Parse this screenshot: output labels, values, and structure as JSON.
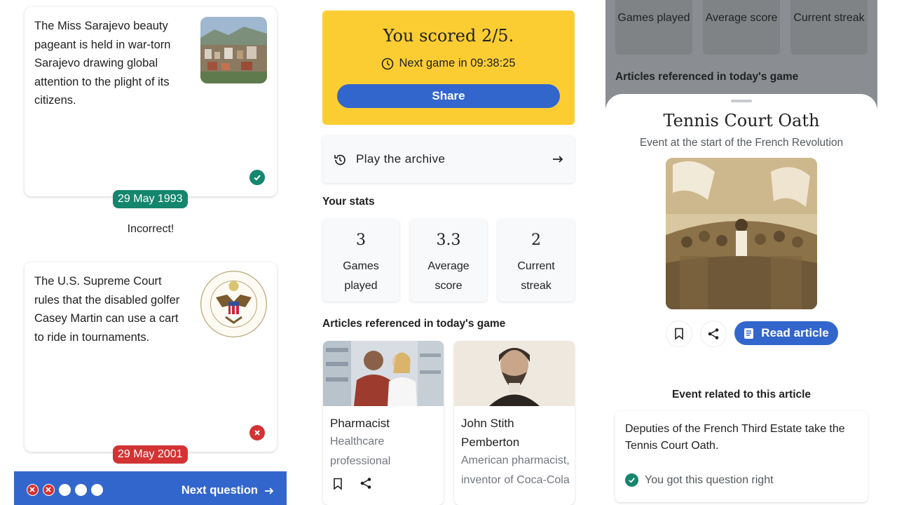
{
  "colors": {
    "accent": "#3366cc",
    "correct_green": "#14866d",
    "incorrect_red": "#d33333",
    "score_yellow": "#fccd33"
  },
  "quiz_panel": {
    "card1": {
      "text": "The Miss Sarajevo beauty pageant is held in war-torn Sarajevo drawing global attention to the plight of its citizens.",
      "image": "sarajevo-city-photo",
      "status_icon": "check-icon",
      "date": "29 May 1993"
    },
    "feedback": "Incorrect!",
    "card2": {
      "text": "The U.S. Supreme Court rules that the disabled golfer Casey Martin can use a cart to ride in tournaments.",
      "image": "supreme-court-seal",
      "status_icon": "close-icon",
      "date": "29 May 2001"
    },
    "progress_dots": [
      "wrong",
      "wrong",
      "pending",
      "pending",
      "pending"
    ],
    "next_question_label": "Next question"
  },
  "results_panel": {
    "score_title": "You scored 2/5.",
    "next_game": "Next game in 09:38:25",
    "share_label": "Share",
    "archive_label": "Play the archive",
    "stats_heading": "Your stats",
    "stats": [
      {
        "value": "3",
        "label": "Games played"
      },
      {
        "value": "3.3",
        "label": "Average score"
      },
      {
        "value": "2",
        "label": "Current streak"
      }
    ],
    "articles_heading": "Articles referenced in today's game",
    "articles": [
      {
        "title": "Pharmacist",
        "description": "Healthcare professional"
      },
      {
        "title": "John Stith Pemberton",
        "description": "American pharmacist, inventor of Coca-Cola"
      }
    ]
  },
  "article_panel": {
    "bg_stats": [
      {
        "label": "Games played"
      },
      {
        "label": "Average score"
      },
      {
        "label": "Current streak"
      }
    ],
    "bg_heading": "Articles referenced in today's game",
    "title": "Tennis Court Oath",
    "subtitle": "Event at the start of the French Revolution",
    "read_label": "Read article",
    "event_heading": "Event related to this article",
    "event_text": "Deputies of the French Third Estate take the Tennis Court Oath.",
    "event_result": "You got this question right"
  }
}
